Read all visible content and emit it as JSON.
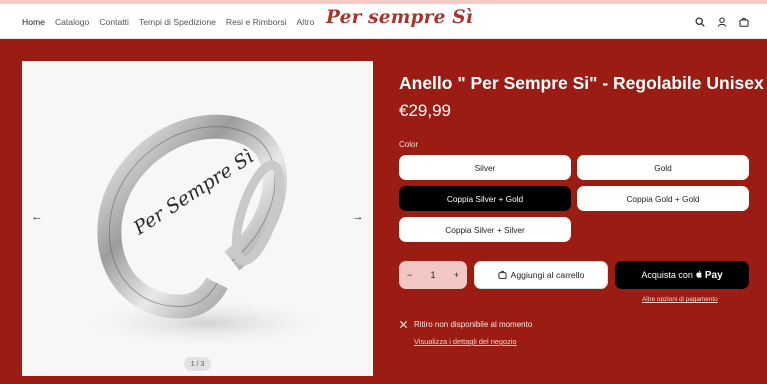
{
  "nav": {
    "items": [
      "Home",
      "Catalogo",
      "Contatti",
      "Tempi di Spedizione",
      "Resi e Rimborsi",
      "Altro"
    ],
    "active_index": 0
  },
  "brand": {
    "logo_text": "Per sempre Sì"
  },
  "header_icons": [
    "search-icon",
    "account-icon",
    "cart-icon"
  ],
  "gallery": {
    "engraving": "Per Sempre Sì",
    "pager_text": "1 / 3"
  },
  "product": {
    "title": "Anello \" Per Sempre Si\" - Regolabile Unisex",
    "price": "€29,99",
    "color_label": "Color",
    "variants": [
      {
        "label": "Silver",
        "selected": false
      },
      {
        "label": "Gold",
        "selected": false
      },
      {
        "label": "Coppia Silver + Gold",
        "selected": true
      },
      {
        "label": "Coppia Gold + Gold",
        "selected": false
      },
      {
        "label": "Coppia Silver + Silver",
        "selected": false
      }
    ],
    "quantity": "1",
    "add_to_cart_label": "Aggiungi al carrello",
    "apple_pay_prefix": "Acquista con",
    "apple_pay_brand": "Pay",
    "more_payment_options": "Altre opzioni di pagamento",
    "pickup_status": "Ritiro non disponibile al momento",
    "pickup_details_link": "Visualizza i dettagli del negozio"
  },
  "colors": {
    "background": "#9a1c12",
    "header_strip": "#f4c9c6",
    "logo": "#a8342c",
    "quantity_bg": "#f2c6c3"
  }
}
